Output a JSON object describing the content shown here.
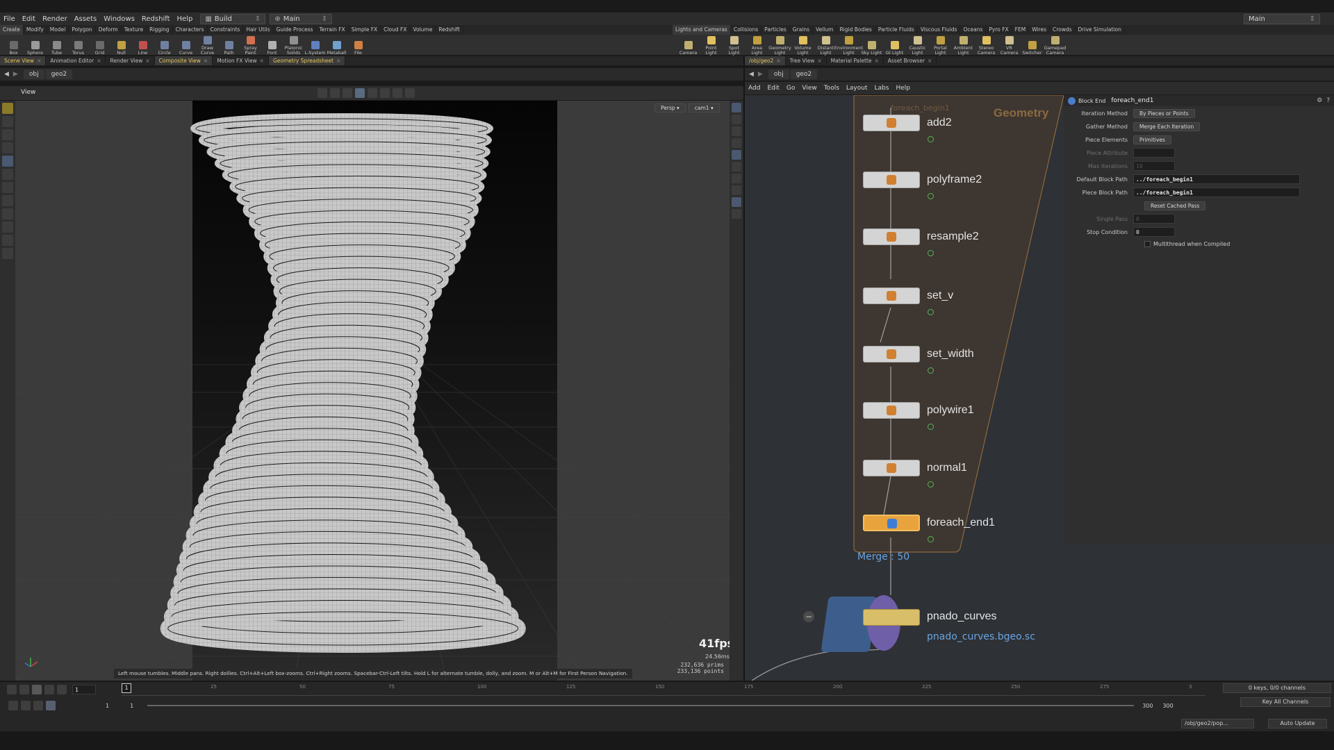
{
  "menus": [
    "File",
    "Edit",
    "Render",
    "Assets",
    "Windows",
    "Redshift",
    "Help"
  ],
  "desktop": {
    "build": "Build",
    "main": "Main"
  },
  "right_desktop": "Main",
  "shelf_tabs_left": [
    "Create",
    "Modify",
    "Model",
    "Polygon",
    "Deform",
    "Texture",
    "Rigging",
    "Characters",
    "Constraints",
    "Hair Utils",
    "Guide Process",
    "Terrain FX",
    "Simple FX",
    "Cloud FX",
    "Volume",
    "Redshift"
  ],
  "shelf_tabs_right": [
    "Lights and Cameras",
    "Collisions",
    "Particles",
    "Grains",
    "Vellum",
    "Rigid Bodies",
    "Particle Fluids",
    "Viscous Fluids",
    "Oceans",
    "Pyro FX",
    "FEM",
    "Wires",
    "Crowds",
    "Drive Simulation"
  ],
  "shelf_tools_left": [
    "Box",
    "Sphere",
    "Tube",
    "Torus",
    "Grid",
    "Null",
    "Line",
    "Circle",
    "Curve",
    "Draw Curve",
    "Path",
    "Spray Paint",
    "Font",
    "Platonic Solids",
    "L-System",
    "Metaball",
    "File"
  ],
  "shelf_tools_right": [
    "Camera",
    "Point Light",
    "Spot Light",
    "Area Light",
    "Geometry Light",
    "Volume Light",
    "Distant Light",
    "Environment Light",
    "Sky Light",
    "GI Light",
    "Caustic Light",
    "Portal Light",
    "Ambient Light",
    "Stereo Camera",
    "VR Camera",
    "Switcher",
    "Gamepad Camera"
  ],
  "left_tabs": [
    "Scene View",
    "Animation Editor",
    "Render View",
    "Composite View",
    "Motion FX View",
    "Geometry Spreadsheet"
  ],
  "right_tabs": [
    "/obj/geo2",
    "Tree View",
    "Material Palette",
    "Asset Browser"
  ],
  "left_path": {
    "obj": "obj",
    "geo": "geo2"
  },
  "right_path": {
    "obj": "obj",
    "geo": "geo2"
  },
  "view_label": "View",
  "view_buttons": {
    "persp": "Persp",
    "cam": "cam1"
  },
  "fps": "41fps",
  "frame_ms": "24.56ms",
  "stats": {
    "prims": "232,636  prims",
    "points": "233,136  points"
  },
  "hint": "Left mouse tumbles. Middle pans. Right dollies. Ctrl+Alt+Left box-zooms. Ctrl+Right zooms. Spacebar-Ctrl-Left tilts. Hold L for alternate tumble, dolly, and zoom.    M or Alt+M for First Person Navigation.",
  "net_menus": [
    "Add",
    "Edit",
    "Go",
    "View",
    "Tools",
    "Layout",
    "Labs",
    "Help"
  ],
  "net_context": "Geometry",
  "net_ghost": "foreach_begin1",
  "nodes": [
    {
      "name": "add2"
    },
    {
      "name": "polyframe2"
    },
    {
      "name": "resample2"
    },
    {
      "name": "set_v"
    },
    {
      "name": "set_width"
    },
    {
      "name": "polywire1"
    },
    {
      "name": "normal1"
    },
    {
      "name": "foreach_end1"
    }
  ],
  "merge_label": "Merge : 50",
  "file_node": {
    "name": "pnado_curves",
    "file": "pnado_curves.bgeo.sc"
  },
  "params": {
    "node_type": "Block End",
    "node_name": "foreach_end1",
    "rows": [
      {
        "label": "Iteration Method",
        "value": "By Pieces or Points"
      },
      {
        "label": "Gather Method",
        "value": "Merge Each Iteration"
      },
      {
        "label": "Piece Elements",
        "value": "Primitives"
      },
      {
        "label": "Piece Attribute",
        "value": ""
      },
      {
        "label": "Max Iterations",
        "value": "10"
      },
      {
        "label": "Default Block Path",
        "value": "../foreach_begin1"
      },
      {
        "label": "Piece Block Path",
        "value": "../foreach_begin1"
      },
      {
        "label": "",
        "value": "Reset Cached Pass"
      },
      {
        "label": "Single Pass",
        "value": "0"
      },
      {
        "label": "Stop Condition",
        "value": "0"
      },
      {
        "label": "",
        "value": "Multithread when Compiled"
      }
    ]
  },
  "timeline": {
    "ticks": [
      "1",
      "25",
      "50",
      "75",
      "100",
      "125",
      "150",
      "175",
      "200",
      "225",
      "250",
      "275",
      "3"
    ],
    "current_frame": "1",
    "frame_field": "1",
    "range_start": "1",
    "range_start2": "1",
    "range_end": "300",
    "range_end2": "300",
    "keys": "0 keys, 0/0 channels",
    "key_all": "Key All Channels"
  },
  "status": {
    "path": "/obj/geo2/pop...",
    "update": "Auto Update"
  }
}
